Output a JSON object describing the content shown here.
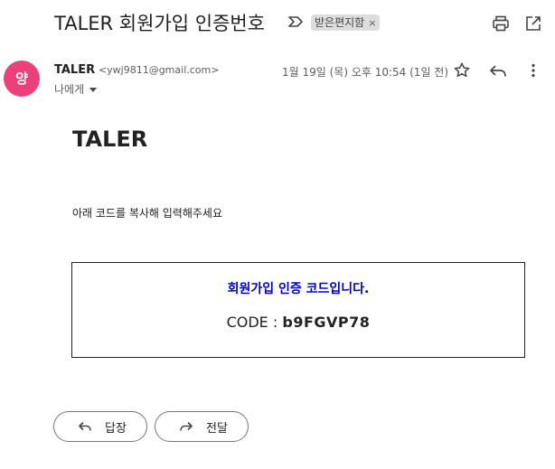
{
  "email": {
    "subject": "TALER 회원가입 인증번호",
    "label": "받은편지함",
    "label_close": "×",
    "sender_name": "TALER",
    "sender_email": "<ywj9811@gmail.com>",
    "avatar_letter": "양",
    "to_text": "나에게",
    "date": "1월 19일 (목) 오후 10:54 (1일 전)"
  },
  "body": {
    "brand": "TALER",
    "instruction": "아래 코드를 복사해 입력해주세요",
    "code_title": "회원가입 인증 코드입니다.",
    "code_prefix": "CODE : ",
    "code_value": "b9FGVP78"
  },
  "actions": {
    "reply_label": "답장",
    "forward_label": "전달"
  },
  "icons": {
    "important": "importance-marker-icon",
    "print": "print-icon",
    "popout": "open-in-new-window-icon",
    "star": "star-icon",
    "reply": "reply-icon",
    "more": "more-vertical-icon",
    "forward": "forward-icon"
  },
  "colors": {
    "avatar": "#ec407a",
    "code_title": "#0000cc",
    "label_chip": "#dddddd"
  }
}
